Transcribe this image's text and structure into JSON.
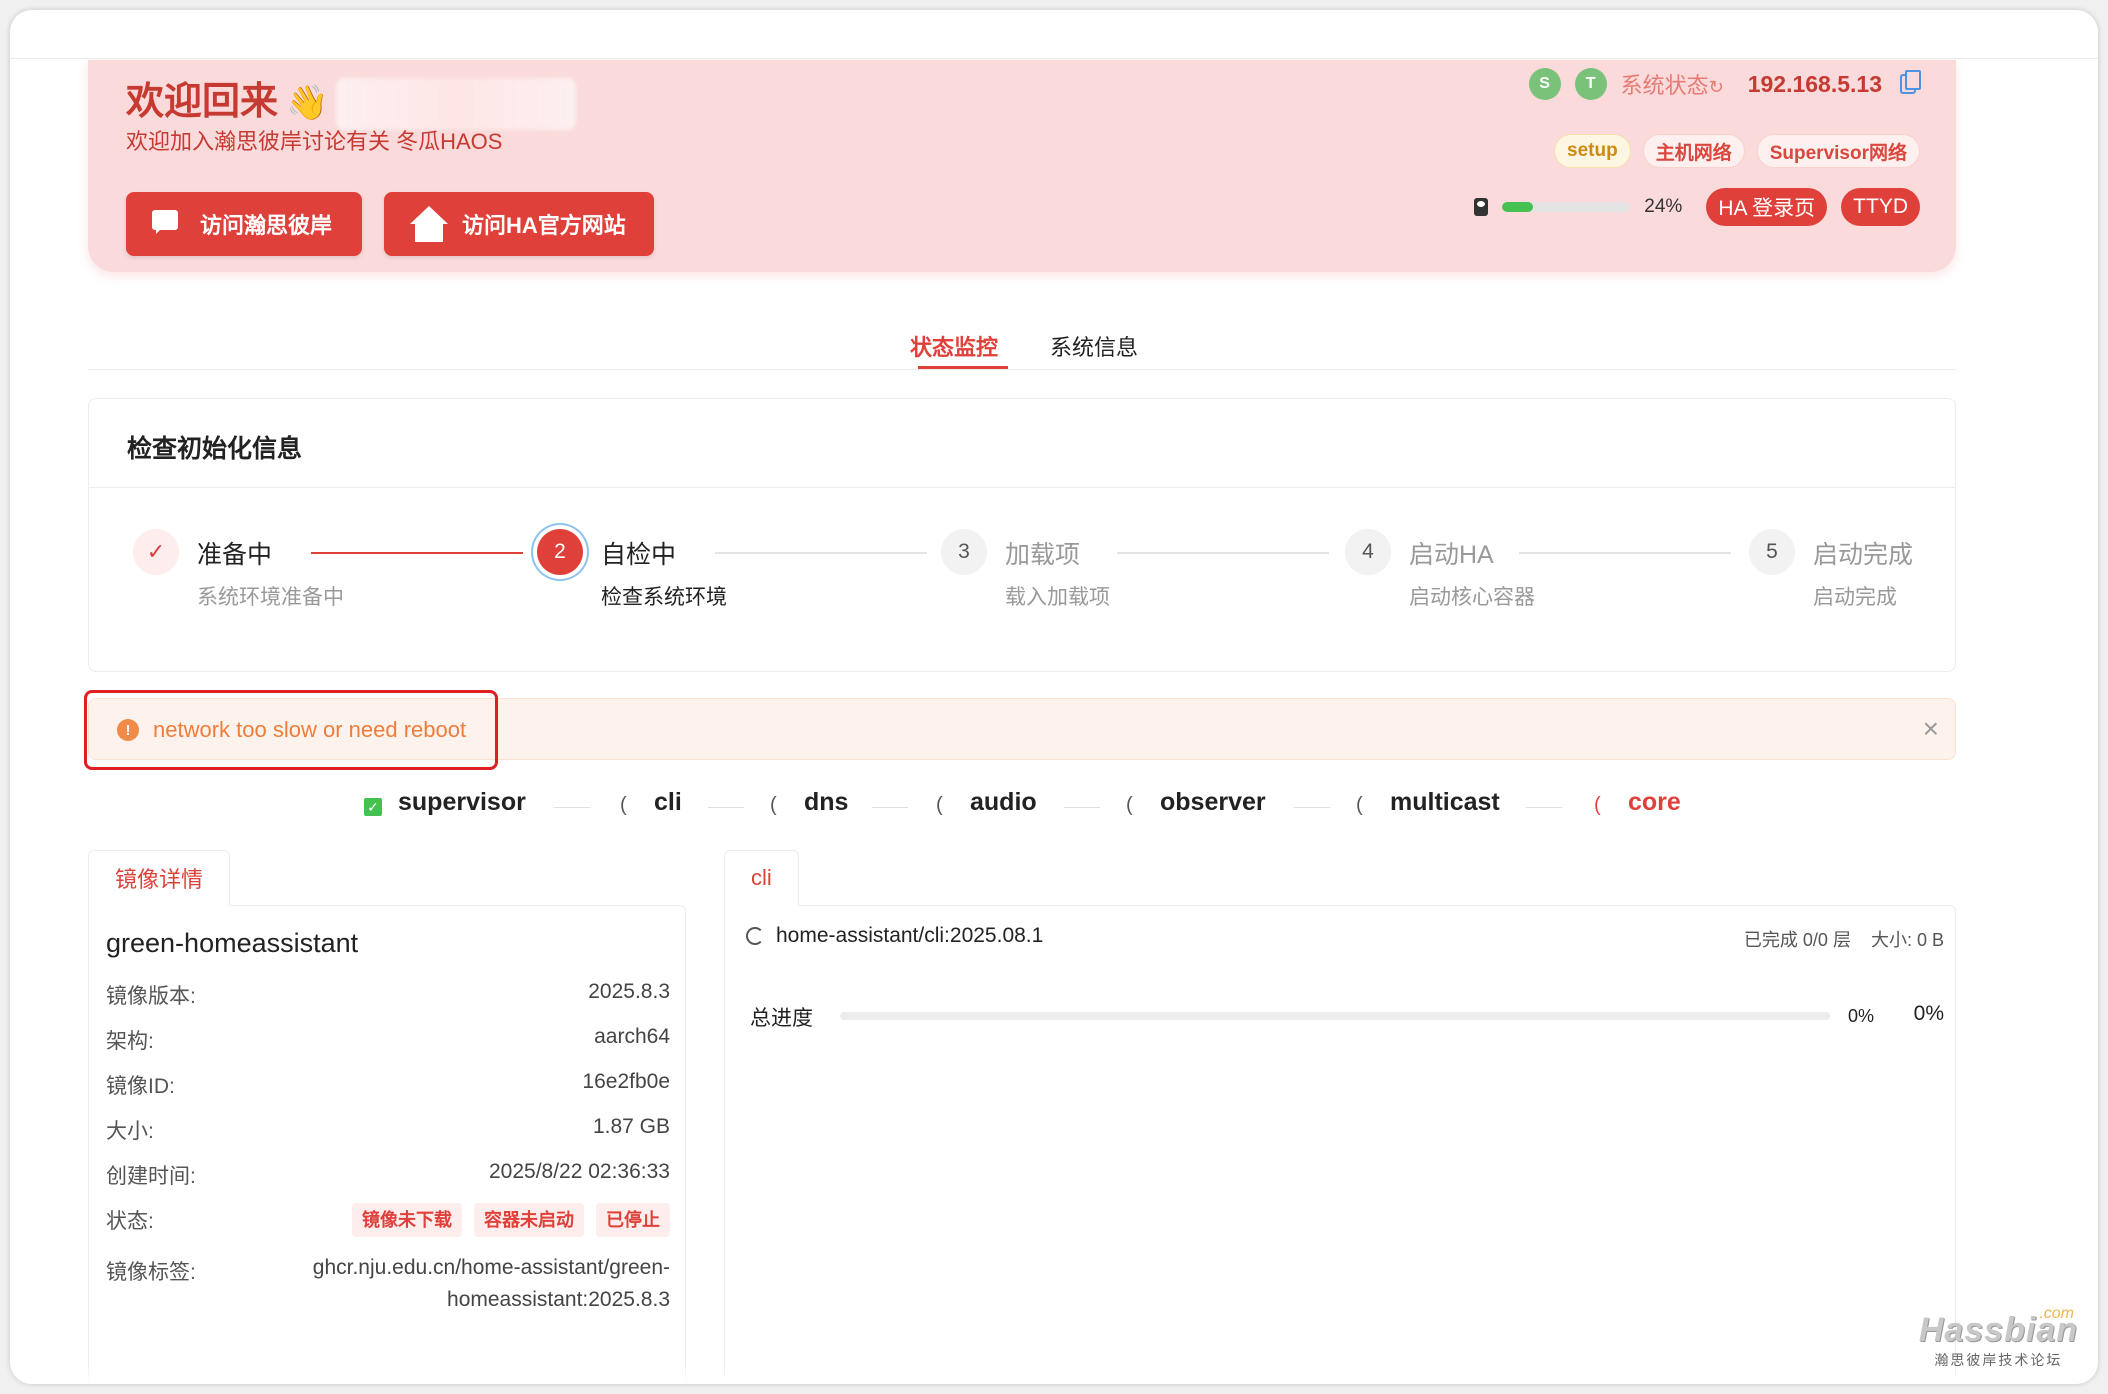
{
  "header": {
    "welcome": "欢迎回来",
    "wave_emoji": "👋",
    "subtitle": "欢迎加入瀚思彼岸讨论有关 冬瓜HAOS",
    "buttons": [
      {
        "label": "访问瀚思彼岸",
        "icon": "chat-icon"
      },
      {
        "label": "访问HA官方网站",
        "icon": "home-assistant-icon"
      }
    ],
    "status_dots": [
      "S",
      "T"
    ],
    "system_status": "系统状态",
    "refresh_icon": "↻",
    "ip": "192.168.5.13",
    "tags": [
      "setup",
      "主机网络",
      "Supervisor网络"
    ],
    "disk_usage_percent": 24,
    "disk_usage_label": "24%",
    "ha_login": "HA 登录页",
    "ttyd": "TTYD"
  },
  "tabs": [
    {
      "label": "状态监控",
      "active": true
    },
    {
      "label": "系统信息",
      "active": false
    }
  ],
  "init_card": {
    "title": "检查初始化信息",
    "steps": [
      {
        "marker": "✓",
        "title": "准备中",
        "desc": "系统环境准备中",
        "state": "done"
      },
      {
        "marker": "2",
        "title": "自检中",
        "desc": "检查系统环境",
        "state": "active"
      },
      {
        "marker": "3",
        "title": "加载项",
        "desc": "载入加载项",
        "state": "pending"
      },
      {
        "marker": "4",
        "title": "启动HA",
        "desc": "启动核心容器",
        "state": "pending"
      },
      {
        "marker": "5",
        "title": "启动完成",
        "desc": "启动完成",
        "state": "pending"
      }
    ]
  },
  "alert": {
    "icon": "!",
    "text": "network too slow or need reboot",
    "close": "×"
  },
  "services": [
    {
      "name": "supervisor",
      "state": "done",
      "marker": "✓"
    },
    {
      "name": "cli",
      "state": "loading",
      "marker": "("
    },
    {
      "name": "dns",
      "state": "loading",
      "marker": "("
    },
    {
      "name": "audio",
      "state": "loading",
      "marker": "("
    },
    {
      "name": "observer",
      "state": "loading",
      "marker": "("
    },
    {
      "name": "multicast",
      "state": "loading",
      "marker": "("
    },
    {
      "name": "core",
      "state": "active",
      "marker": "("
    }
  ],
  "image_panel": {
    "tab": "镜像详情",
    "name": "green-homeassistant",
    "rows": [
      {
        "key": "镜像版本:",
        "value": "2025.8.3"
      },
      {
        "key": "架构:",
        "value": "aarch64"
      },
      {
        "key": "镜像ID:",
        "value": "16e2fb0e"
      },
      {
        "key": "大小:",
        "value": "1.87 GB"
      },
      {
        "key": "创建时间:",
        "value": "2025/8/22 02:36:33"
      }
    ],
    "status_key": "状态:",
    "status_badges": [
      "镜像未下载",
      "容器未启动",
      "已停止"
    ],
    "tag_key": "镜像标签:",
    "tag_value_line1": "ghcr.nju.edu.cn/home-assistant/green-",
    "tag_value_line2": "homeassistant:2025.8.3"
  },
  "pull_panel": {
    "tab": "cli",
    "image": "home-assistant/cli:2025.08.1",
    "layers": "已完成 0/0 层",
    "size": "大小: 0 B",
    "total_label": "总进度",
    "total_percent": 0,
    "total_small": "0%",
    "total_big": "0%"
  },
  "watermark": {
    "logo": "Hassbian",
    "com": ".com",
    "text": "瀚思彼岸技术论坛"
  },
  "colors": {
    "accent": "#e0403a",
    "banner": "#fadada",
    "success": "#44c150",
    "warning": "#ee7d3c"
  }
}
